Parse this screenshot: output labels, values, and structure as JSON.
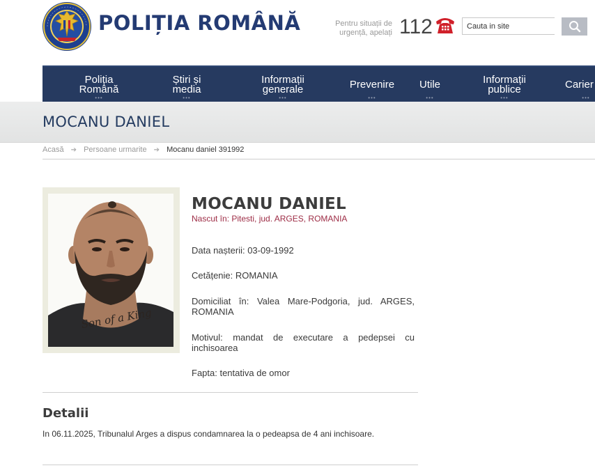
{
  "header": {
    "site_title": "POLIȚIA ROMÂNĂ",
    "emergency_text_line1": "Pentru situații de",
    "emergency_text_line2": "urgență, apelați",
    "emergency_number": "112",
    "search_placeholder": "Cauta in site",
    "phone_icon": "phone-icon",
    "search_icon": "magnifier-icon",
    "colors": {
      "brand": "#243b73",
      "nav_bg": "#263a60",
      "phone": "#d0202a",
      "accent": "#9d2c45"
    }
  },
  "nav": {
    "items": [
      {
        "line1": "Poliția",
        "line2": "Română"
      },
      {
        "line1": "Știri și",
        "line2": "media"
      },
      {
        "line1": "Informații",
        "line2": "generale"
      },
      {
        "line1": "Prevenire",
        "line2": ""
      },
      {
        "line1": "Utile",
        "line2": ""
      },
      {
        "line1": "Informații",
        "line2": "publice"
      },
      {
        "line1": "Carier",
        "line2": ""
      }
    ],
    "dots": "•••"
  },
  "banner": {
    "title": "MOCANU DANIEL"
  },
  "breadcrumb": {
    "home": "Acasă",
    "section": "Persoane urmarite",
    "current": "Mocanu daniel 391992",
    "separator": "➔"
  },
  "profile": {
    "name": "MOCANU DANIEL",
    "birthplace": "Nascut în: Pitesti, jud. ARGES, ROMANIA",
    "dob": "Data nașterii: 03-09-1992",
    "citizenship": "Cetățenie: ROMANIA",
    "residence": "Domiciliat în: Valea Mare-Podgoria, jud. ARGES, ROMANIA",
    "reason": "Motivul: mandat de executare a pedepsei cu inchisoarea",
    "deed": "Fapta: tentativa de omor",
    "tattoo_text": "Son of a King"
  },
  "details": {
    "title": "Detalii",
    "text": "In 06.11.2025, Tribunalul Arges a dispus condamnarea la o pedeapsa de 4 ani inchisoare."
  }
}
